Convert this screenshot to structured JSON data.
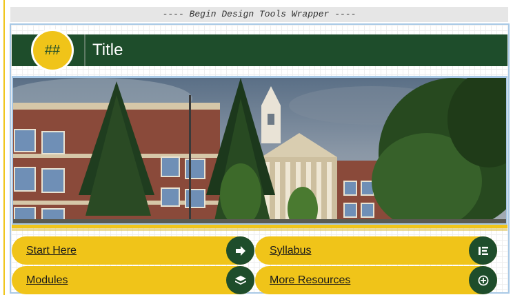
{
  "wrapper_banner": "---- Begin Design Tools Wrapper ----",
  "header": {
    "badge": "##",
    "title": "Title"
  },
  "nav": [
    {
      "label": "Start Here",
      "icon": "arrow-right-icon"
    },
    {
      "label": "Syllabus",
      "icon": "list-icon"
    },
    {
      "label": "Modules",
      "icon": "layers-icon"
    },
    {
      "label": "More Resources",
      "icon": "plus-circle-icon"
    }
  ],
  "colors": {
    "green": "#1e4d2b",
    "gold": "#f0c419",
    "frame": "#a9c9e6"
  }
}
